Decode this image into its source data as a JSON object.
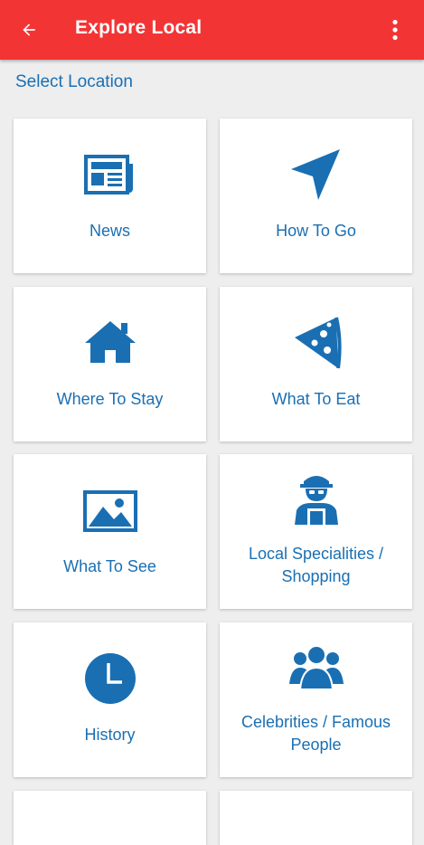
{
  "header": {
    "title": "Explore Local",
    "background": "#f33435",
    "back_icon": "arrow-back-icon",
    "menu_icon": "more-vert-icon"
  },
  "select_location": "Select Location",
  "accent_color": "#1a6fb3",
  "tiles": [
    {
      "label": "News",
      "icon": "newspaper-icon"
    },
    {
      "label": "How To Go",
      "icon": "navigation-arrow-icon"
    },
    {
      "label": "Where To Stay",
      "icon": "home-icon"
    },
    {
      "label": "What To Eat",
      "icon": "pizza-icon"
    },
    {
      "label": "What To See",
      "icon": "landscape-image-icon"
    },
    {
      "label": "Local Specialities / Shopping",
      "icon": "vendor-person-icon"
    },
    {
      "label": "History",
      "icon": "clock-icon"
    },
    {
      "label": "Celebrities / Famous People",
      "icon": "group-people-icon"
    }
  ]
}
